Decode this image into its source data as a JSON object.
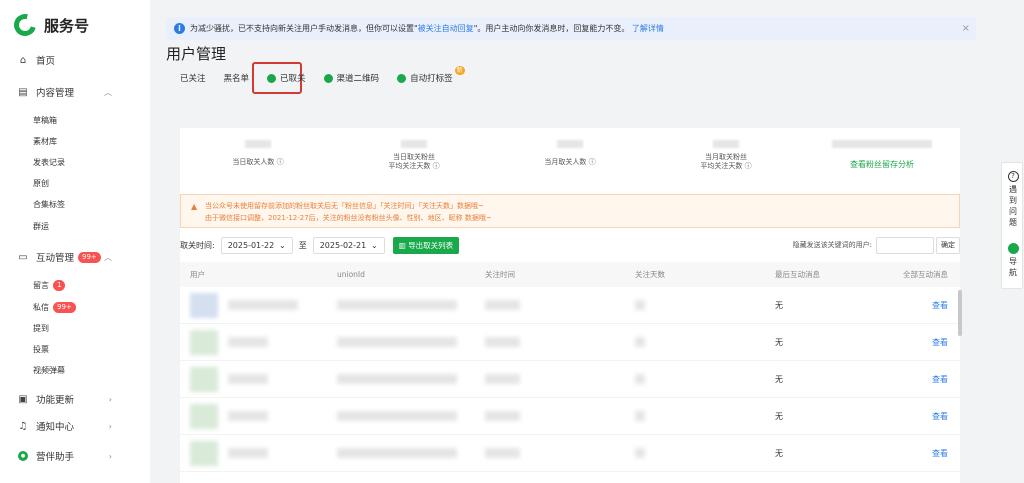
{
  "brand": {
    "title": "服务号",
    "accent": "#19a94a"
  },
  "sidebar": {
    "home": "首页",
    "content": "内容管理",
    "content_items": [
      "草稿箱",
      "素材库",
      "发表记录",
      "原创",
      "合集标签",
      "群运"
    ],
    "interaction": "互动管理",
    "interaction_badge": "99+",
    "interaction_items": [
      {
        "label": "留言",
        "badge": "1"
      },
      {
        "label": "私信",
        "badge": "99+"
      },
      {
        "label": "提到",
        "badge": ""
      },
      {
        "label": "投票",
        "badge": ""
      },
      {
        "label": "视频弹幕",
        "badge": ""
      }
    ],
    "features": "功能更新",
    "notifications": "通知中心",
    "assistant": "营伴助手"
  },
  "notice": {
    "text": "为减少骚扰，已不支持向新关注用户手动发消息，但你可以设置\"",
    "link": "被关注自动回复",
    "text2": "\"。用户主动向你发消息时，回复能力不变。",
    "more": "了解详情"
  },
  "page_title": "用户管理",
  "tabs": [
    "已关注",
    "黑名单",
    "已取关",
    "渠道二维码",
    "自动打标签"
  ],
  "new_tag": "新",
  "stats": [
    {
      "label": "当日取关人数 ⓘ"
    },
    {
      "label": "当日取关粉丝\n平均关注天数 ⓘ"
    },
    {
      "label": "当月取关人数 ⓘ"
    },
    {
      "label": "当月取关粉丝\n平均关注天数 ⓘ"
    },
    {
      "label": "查看粉丝留存分析"
    }
  ],
  "warning": {
    "line1": "当公众号未使用留存前添加的粉丝取关后无「粉丝信息」「关注时间」「关注天数」数据哦~",
    "line2": "由于微信接口调整，2021-12-27后，关注的粉丝没有粉丝头像、性别、地区、昵称 数据哦~"
  },
  "filter": {
    "label": "取关时间:",
    "start": "2025-01-22",
    "sep": "至",
    "end": "2025-02-21",
    "export": "导出取关列表",
    "search_label": "隐藏发送该关键词的用户:",
    "search_button": "确定"
  },
  "table": {
    "headers": [
      "用户",
      "unionId",
      "关注时间",
      "关注天数",
      "最后互动消息",
      "全部互动消息"
    ],
    "rows": [
      {
        "last_msg": "无",
        "action": "查看"
      },
      {
        "last_msg": "无",
        "action": "查看"
      },
      {
        "last_msg": "无",
        "action": "查看"
      },
      {
        "last_msg": "无",
        "action": "查看"
      },
      {
        "last_msg": "无",
        "action": "查看"
      }
    ]
  },
  "float_panel": {
    "help": "遇到问题",
    "nav": "导航"
  }
}
